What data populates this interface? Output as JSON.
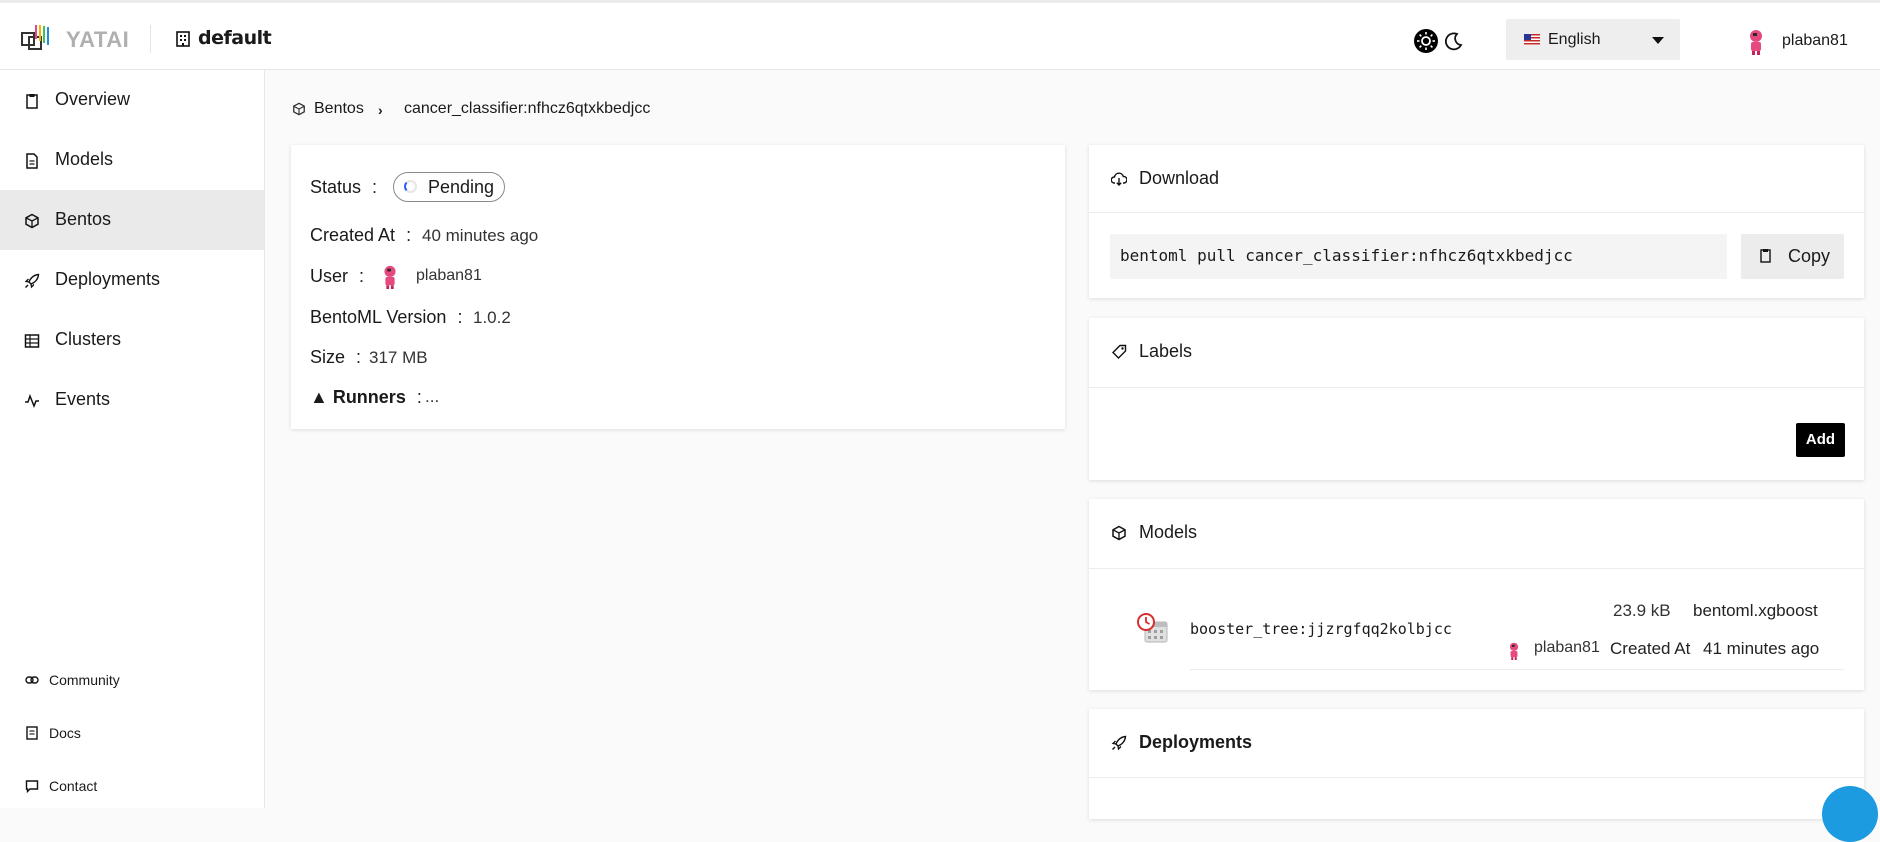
{
  "app": {
    "name": "YATAI",
    "organization": "default"
  },
  "header": {
    "language": "English",
    "user": "plaban81",
    "icons": {
      "theme_light": "sun-icon",
      "theme_dark": "moon-icon",
      "flag": "us-flag-icon"
    }
  },
  "sidebar": {
    "items": [
      {
        "label": "Overview",
        "icon": "clipboard-icon"
      },
      {
        "label": "Models",
        "icon": "document-icon"
      },
      {
        "label": "Bentos",
        "icon": "cube-icon",
        "active": true
      },
      {
        "label": "Deployments",
        "icon": "rocket-icon"
      },
      {
        "label": "Clusters",
        "icon": "table-icon"
      },
      {
        "label": "Events",
        "icon": "activity-icon"
      }
    ],
    "footer": [
      {
        "label": "Community",
        "icon": "link-icon"
      },
      {
        "label": "Docs",
        "icon": "docs-icon"
      },
      {
        "label": "Contact",
        "icon": "chat-icon"
      }
    ]
  },
  "breadcrumb": {
    "root": "Bentos",
    "current": "cancer_classifier:nfhcz6qtxkbedjcc"
  },
  "info": {
    "status_label": "Status",
    "status_value": "Pending",
    "created_label": "Created At",
    "created_value": "40 minutes ago",
    "user_label": "User",
    "user_value": "plaban81",
    "version_label": "BentoML Version",
    "version_value": "1.0.2",
    "size_label": "Size",
    "size_value": "317 MB",
    "runners_label": "▲ Runners",
    "runners_value": "...",
    "colon": ":"
  },
  "download": {
    "title": "Download",
    "command": "bentoml pull cancer_classifier:nfhcz6qtxkbedjcc",
    "copy_label": "Copy"
  },
  "labels": {
    "title": "Labels",
    "add_label": "Add"
  },
  "models": {
    "title": "Models",
    "items": [
      {
        "name": "booster_tree:jjzrgfqq2kolbjcc",
        "size": "23.9 kB",
        "type": "bentoml.xgboost",
        "user": "plaban81",
        "created_label": "Created At",
        "created_value": "41 minutes ago"
      }
    ]
  },
  "deployments": {
    "title": "Deployments"
  },
  "colors": {
    "accent": "#000000",
    "active_nav": "#eaeaea",
    "spinner": "#2962ff",
    "chat": "#1c9be0"
  }
}
